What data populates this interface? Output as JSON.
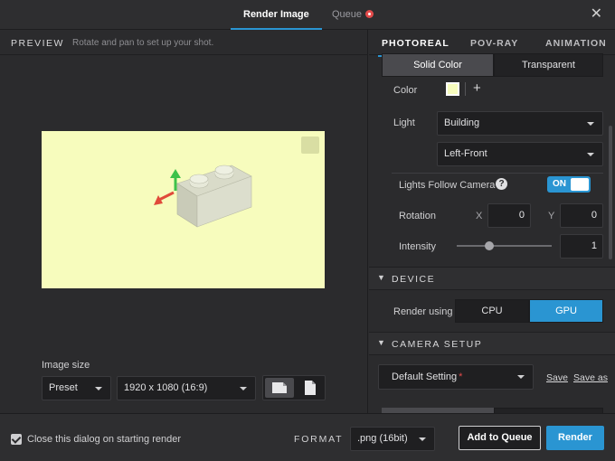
{
  "header": {
    "tab_render": "Render Image",
    "tab_queue": "Queue",
    "close_icon": "close-icon"
  },
  "preview": {
    "title": "PREVIEW",
    "hint": "Rotate and pan to set up your shot.",
    "canvas_color": "#f7fcbd"
  },
  "image_size": {
    "label": "Image size",
    "preset": "Preset",
    "resolution": "1920 x 1080 (16:9)"
  },
  "right_tabs": [
    "PHOTOREAL",
    "POV-RAY",
    "ANIMATION"
  ],
  "background": {
    "option_solid": "Solid Color",
    "option_transparent": "Transparent",
    "color_label": "Color",
    "add_symbol": "+"
  },
  "light": {
    "label": "Light",
    "value": "Building",
    "direction": "Left-Front"
  },
  "lights_follow": {
    "label": "Lights Follow Camera",
    "help": "?",
    "toggle": "ON"
  },
  "rotation": {
    "label": "Rotation",
    "x_label": "X",
    "x_value": "0",
    "y_label": "Y",
    "y_value": "0"
  },
  "intensity": {
    "label": "Intensity",
    "value": "1"
  },
  "device": {
    "title": "DEVICE",
    "render_using": "Render using",
    "cpu": "CPU",
    "gpu": "GPU"
  },
  "camera": {
    "title": "CAMERA SETUP",
    "setting": "Default Setting",
    "required_mark": "*",
    "save": "Save",
    "save_as": "Save as"
  },
  "footer": {
    "close_dialog": "Close this dialog on starting render",
    "format_label": "FORMAT",
    "format_value": ".png (16bit)",
    "add_to_queue": "Add to Queue",
    "render": "Render"
  },
  "colors": {
    "accent": "#2a95d2",
    "queue_badge": "#e24b4b"
  }
}
